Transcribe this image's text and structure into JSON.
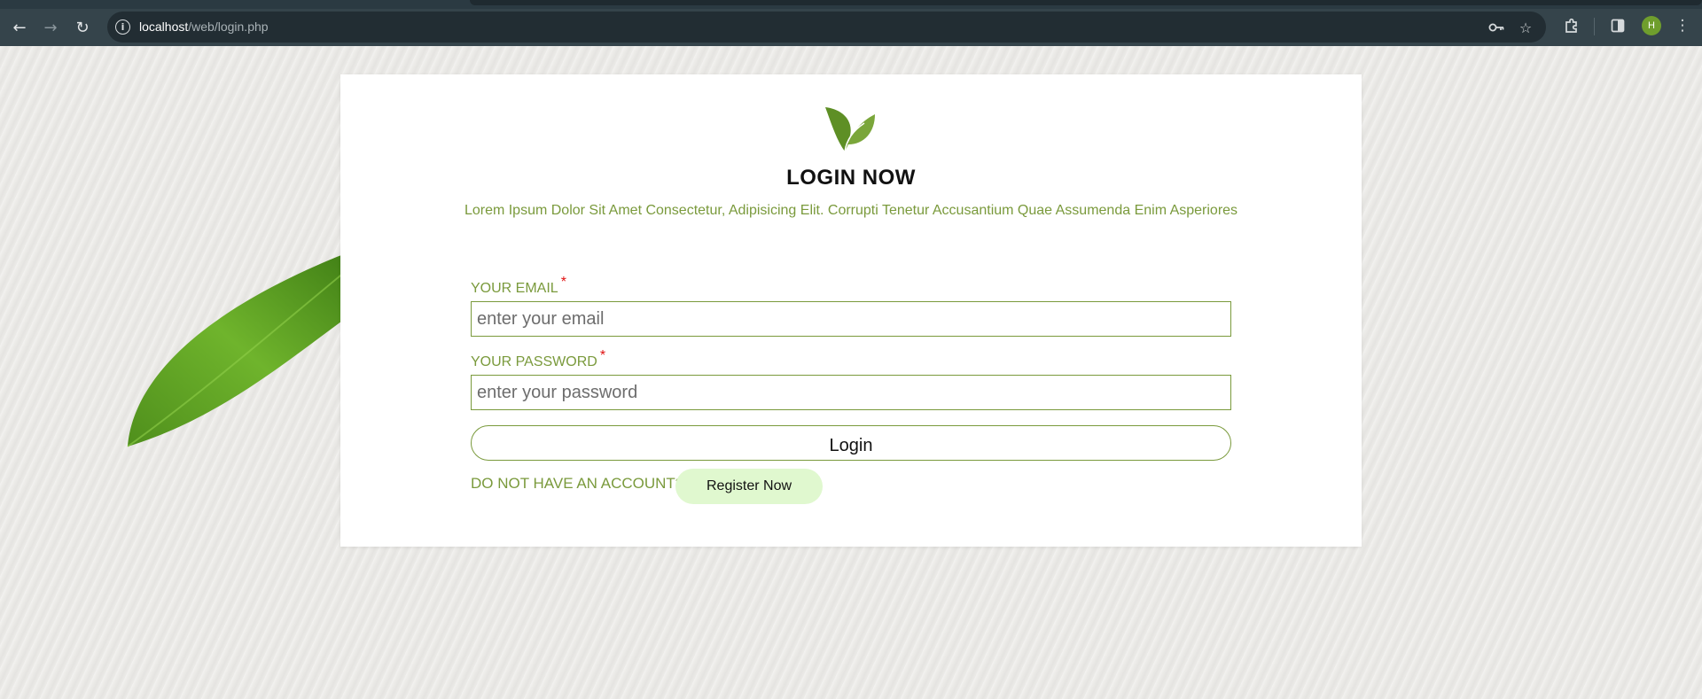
{
  "browser": {
    "url_host": "localhost",
    "url_path": "/web/login.php",
    "profile_initial": "H"
  },
  "login": {
    "title": "LOGIN NOW",
    "subtitle": "Lorem Ipsum Dolor Sit Amet Consectetur, Adipisicing Elit. Corrupti Tenetur Accusantium Quae Assumenda Enim Asperiores",
    "email_label": "YOUR EMAIL",
    "email_placeholder": "enter your email",
    "email_value": "",
    "password_label": "YOUR PASSWORD",
    "password_placeholder": "enter your password",
    "password_value": "",
    "required_mark": "*",
    "login_button": "Login",
    "no_account_text": "DO NOT HAVE AN ACCOUNT?",
    "register_button": "Register Now"
  },
  "colors": {
    "accent_green": "#7a9a3c",
    "register_bg": "#e0f8cf",
    "required_red": "#e01010"
  }
}
